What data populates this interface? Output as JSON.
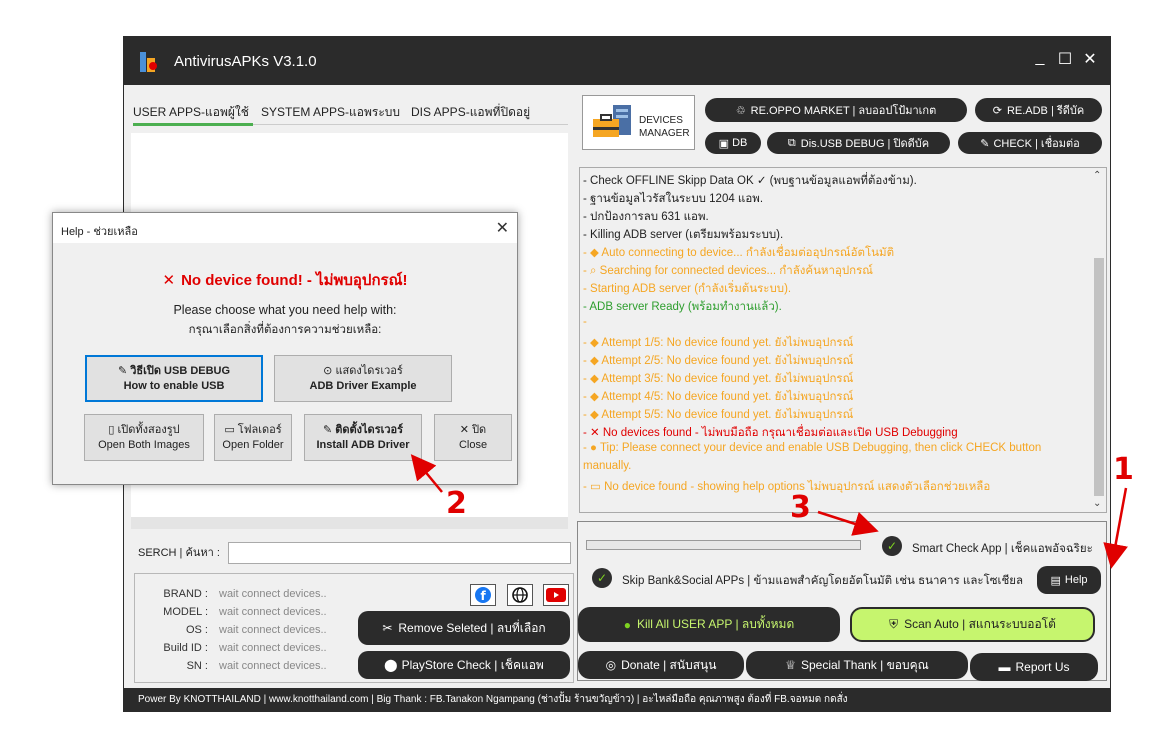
{
  "window": {
    "title": "AntivirusAPKs V3.1.0",
    "controls": {
      "minimize": "_",
      "maximize": "☐",
      "close": "✕"
    }
  },
  "tabs": [
    {
      "label": "USER APPS-แอพผู้ใช้"
    },
    {
      "label": "SYSTEM APPS-แอพระบบ"
    },
    {
      "label": "DIS APPS-แอพที่ปิดอยู่"
    }
  ],
  "search": {
    "label": "SERCH | ค้นหา :",
    "value": ""
  },
  "device_info": {
    "rows": [
      {
        "label": "BRAND :",
        "value": "wait connect devices.."
      },
      {
        "label": "MODEL :",
        "value": "wait connect devices.."
      },
      {
        "label": "OS :",
        "value": "wait connect devices.."
      },
      {
        "label": "Build ID :",
        "value": "wait connect devices.."
      },
      {
        "label": "SN :",
        "value": "wait connect devices.."
      }
    ]
  },
  "left_buttons": {
    "remove": "Remove Seleted | ลบที่เลือก",
    "playstore": "PlayStore Check | เช็คแอพ"
  },
  "devices_manager": {
    "label_line1": "DEVICES",
    "label_line2": "MANAGER"
  },
  "top_buttons": {
    "oppo": "RE.OPPO MARKET | ลบออปโป้มาเกต",
    "readb": "RE.ADB | รีดีบัค",
    "db": "DB",
    "disusb": "Dis.USB DEBUG | ปิดดีบัค",
    "check": "CHECK | เชื่อมต่อ"
  },
  "log": [
    {
      "text": "- Check OFFLINE Skipp Data OK ✓ (พบฐานข้อมูลแอพที่ต้องข้าม).",
      "color": "#222222"
    },
    {
      "text": "- ฐานข้อมูลไวรัสในระบบ 1204 แอพ.",
      "color": "#222222"
    },
    {
      "text": "- ปกป้องการลบ 631 แอพ.",
      "color": "#222222"
    },
    {
      "text": "- Killing ADB server (เตรียมพร้อมระบบ).",
      "color": "#222222"
    },
    {
      "text": "- ◆ Auto connecting to device... กำลังเชื่อมต่ออุปกรณ์อัตโนมัติ",
      "color": "#f5a623"
    },
    {
      "text": "- ⌕ Searching for connected devices... กำลังค้นหาอุปกรณ์",
      "color": "#f5a623"
    },
    {
      "text": "- Starting ADB server (กำลังเริ่มต้นระบบ).",
      "color": "#f5a623"
    },
    {
      "text": "- ADB server Ready (พร้อมทำงานแล้ว).",
      "color": "#2e9e2e"
    },
    {
      "text": "-",
      "color": "#f5a623"
    },
    {
      "text": "- ◆ Attempt 1/5: No device found yet. ยังไม่พบอุปกรณ์",
      "color": "#f5a623"
    },
    {
      "text": "- ◆ Attempt 2/5: No device found yet. ยังไม่พบอุปกรณ์",
      "color": "#f5a623"
    },
    {
      "text": "- ◆ Attempt 3/5: No device found yet. ยังไม่พบอุปกรณ์",
      "color": "#f5a623"
    },
    {
      "text": "- ◆ Attempt 4/5: No device found yet. ยังไม่พบอุปกรณ์",
      "color": "#f5a623"
    },
    {
      "text": "- ◆ Attempt 5/5: No device found yet. ยังไม่พบอุปกรณ์",
      "color": "#f5a623"
    },
    {
      "text": "- ✕ No devices found - ไม่พบมือถือ กรุณาเชื่อมต่อและเปิด USB Debugging",
      "color": "#e00000"
    },
    {
      "text": "- ● Tip: Please connect your device and enable USB Debugging, then click CHECK button",
      "color": "#f5a623"
    },
    {
      "text": "manually.",
      "color": "#f5a623"
    },
    {
      "text": "- ▭ No device found - showing help options ไม่พบอุปกรณ์ แสดงตัวเลือกช่วยเหลือ",
      "color": "#f5a623"
    }
  ],
  "bottom": {
    "smart_check": "Smart Check App | เช็คแอพอัจฉริยะ",
    "skip_bank": "Skip Bank&Social APPs | ข้ามแอพสำคัญโดยอัตโนมัติ เช่น ธนาคาร และโซเชียล",
    "help": "Help",
    "kill_all": "Kill All USER APP | ลบทั้งหมด",
    "scan_auto": "Scan Auto | สแกนระบบออโต้",
    "donate": "Donate | สนับสนุน",
    "special_thank": "Special Thank | ขอบคุณ",
    "report": "Report Us"
  },
  "statusbar": "Power By KNOTTHAILAND | www.knotthailand.com | Big Thank : FB.Tanakon Ngampang (ช่างปั้ม ร้านขวัญข้าว) | อะไหล่มือถือ คุณภาพสูง ต้องที่ FB.จอหมด กดสั่ง",
  "dialog": {
    "title": "Help - ช่วยเหลือ",
    "heading": "No device found! - ไม่พบอุปกรณ์!",
    "instruction_en": "Please choose what you need help with:",
    "instruction_th": "กรุณาเลือกสิ่งที่ต้องการความช่วยเหลือ:",
    "buttons": {
      "usb_th": "วิธีเปิด USB DEBUG",
      "usb_en": "How to enable USB",
      "driver_th": "แสดงไดรเวอร์",
      "driver_en": "ADB Driver Example",
      "images_th": "เปิดทั้งสองรูป",
      "images_en": "Open Both Images",
      "folder_th": "โฟลเดอร์",
      "folder_en": "Open Folder",
      "install_th": "ติดตั้งไดรเวอร์",
      "install_en": "Install ADB Driver",
      "close_th": "ปิด",
      "close_en": "Close"
    }
  },
  "annotations": {
    "one": "1",
    "two": "2",
    "three": "3"
  },
  "colors": {
    "accent_green": "#c6f56e",
    "dark": "#2b2b2b",
    "error_red": "#e00000",
    "warn_orange": "#f5a623",
    "ok_green": "#2e9e2e"
  }
}
